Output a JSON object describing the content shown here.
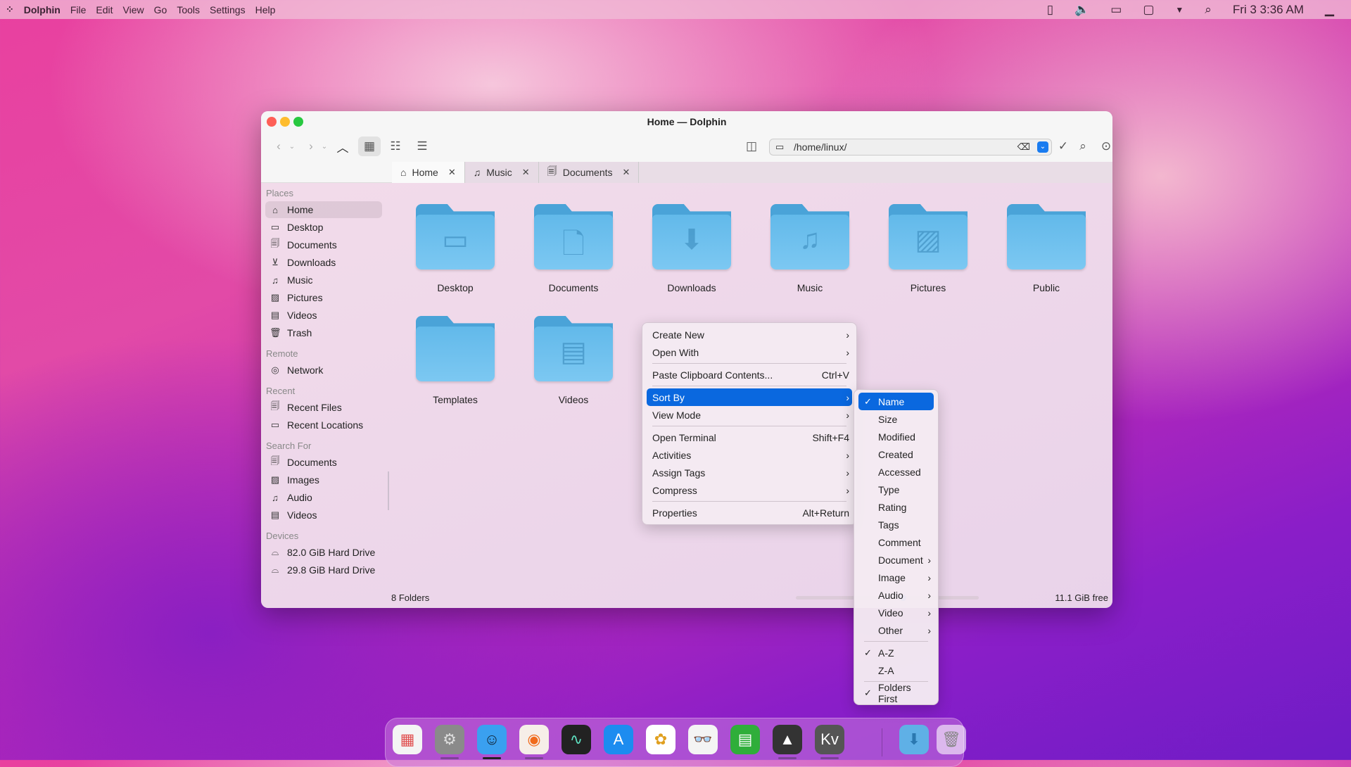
{
  "menubar": {
    "app": "Dolphin",
    "items": [
      "File",
      "Edit",
      "View",
      "Go",
      "Tools",
      "Settings",
      "Help"
    ],
    "clock": "Fri 3 3:36 AM"
  },
  "window": {
    "title": "Home — Dolphin",
    "location": "/home/linux/"
  },
  "tabs": [
    {
      "label": "Home",
      "icon": "home-icon"
    },
    {
      "label": "Music",
      "icon": "music-icon"
    },
    {
      "label": "Documents",
      "icon": "documents-icon"
    }
  ],
  "sidebar": {
    "places_heading": "Places",
    "places": [
      {
        "label": "Home",
        "icon": "⌂"
      },
      {
        "label": "Desktop",
        "icon": "▭"
      },
      {
        "label": "Documents",
        "icon": "🗐"
      },
      {
        "label": "Downloads",
        "icon": "⊻"
      },
      {
        "label": "Music",
        "icon": "♫"
      },
      {
        "label": "Pictures",
        "icon": "▨"
      },
      {
        "label": "Videos",
        "icon": "▤"
      },
      {
        "label": "Trash",
        "icon": "🗑"
      }
    ],
    "remote_heading": "Remote",
    "remote": [
      {
        "label": "Network",
        "icon": "◎"
      }
    ],
    "recent_heading": "Recent",
    "recent": [
      {
        "label": "Recent Files",
        "icon": "🗐"
      },
      {
        "label": "Recent Locations",
        "icon": "▭"
      }
    ],
    "search_heading": "Search For",
    "search": [
      {
        "label": "Documents",
        "icon": "🗐"
      },
      {
        "label": "Images",
        "icon": "▨"
      },
      {
        "label": "Audio",
        "icon": "♫"
      },
      {
        "label": "Videos",
        "icon": "▤"
      }
    ],
    "devices_heading": "Devices",
    "devices": [
      {
        "label": "82.0 GiB Hard Drive",
        "icon": "⌓"
      },
      {
        "label": "29.8 GiB Hard Drive",
        "icon": "⌓"
      }
    ]
  },
  "folders": [
    {
      "label": "Desktop",
      "glyph": "▭"
    },
    {
      "label": "Documents",
      "glyph": "🗋"
    },
    {
      "label": "Downloads",
      "glyph": "⬇"
    },
    {
      "label": "Music",
      "glyph": "♫"
    },
    {
      "label": "Pictures",
      "glyph": "▨"
    },
    {
      "label": "Public",
      "glyph": ""
    },
    {
      "label": "Templates",
      "glyph": ""
    },
    {
      "label": "Videos",
      "glyph": "▤"
    }
  ],
  "status": {
    "count": "8 Folders",
    "free": "11.1 GiB free",
    "zoom_level": 0.05,
    "disk_used_fraction": 0.0
  },
  "context_menu": [
    {
      "label": "Create New",
      "sub": true
    },
    {
      "label": "Open With",
      "sub": true
    },
    {
      "sep": true
    },
    {
      "label": "Paste Clipboard Contents...",
      "shortcut": "Ctrl+V"
    },
    {
      "sep": true
    },
    {
      "label": "Sort By",
      "sub": true,
      "highlight": true
    },
    {
      "label": "View Mode",
      "sub": true
    },
    {
      "sep": true
    },
    {
      "label": "Open Terminal",
      "shortcut": "Shift+F4"
    },
    {
      "label": "Activities",
      "sub": true
    },
    {
      "label": "Assign Tags",
      "sub": true
    },
    {
      "label": "Compress",
      "sub": true
    },
    {
      "sep": true
    },
    {
      "label": "Properties",
      "shortcut": "Alt+Return"
    }
  ],
  "sort_menu": [
    {
      "label": "Name",
      "checked": true,
      "highlight": true
    },
    {
      "label": "Size"
    },
    {
      "label": "Modified"
    },
    {
      "label": "Created"
    },
    {
      "label": "Accessed"
    },
    {
      "label": "Type"
    },
    {
      "label": "Rating"
    },
    {
      "label": "Tags"
    },
    {
      "label": "Comment"
    },
    {
      "label": "Document",
      "sub": true
    },
    {
      "label": "Image",
      "sub": true
    },
    {
      "label": "Audio",
      "sub": true
    },
    {
      "label": "Video",
      "sub": true
    },
    {
      "label": "Other",
      "sub": true
    },
    {
      "sep": true
    },
    {
      "label": "A-Z",
      "checked": true
    },
    {
      "label": "Z-A"
    },
    {
      "sep": true
    },
    {
      "label": "Folders First",
      "checked": true
    }
  ],
  "dock": [
    {
      "name": "launchpad",
      "bg": "#f4f4f4",
      "glyph": "▦",
      "color": "#e05050",
      "running": false
    },
    {
      "name": "system-settings",
      "bg": "#8a8a8a",
      "glyph": "⚙",
      "color": "#ddd",
      "running": true
    },
    {
      "name": "finder",
      "bg": "#3aa0f0",
      "glyph": "☺",
      "color": "#123",
      "running": true,
      "active": true
    },
    {
      "name": "firefox",
      "bg": "#f6eee8",
      "glyph": "◉",
      "color": "#f06a1c",
      "running": true
    },
    {
      "name": "activity-monitor",
      "bg": "#222",
      "glyph": "∿",
      "color": "#5ee0c0",
      "running": false
    },
    {
      "name": "app-store",
      "bg": "#1c8cf0",
      "glyph": "A",
      "color": "#fff",
      "running": false
    },
    {
      "name": "photos",
      "bg": "#fff",
      "glyph": "✿",
      "color": "#e0a020",
      "running": false
    },
    {
      "name": "preview",
      "bg": "#f4f4f4",
      "glyph": "👓",
      "color": "#333",
      "running": false
    },
    {
      "name": "spreadsheet",
      "bg": "#2fae3a",
      "glyph": "▤",
      "color": "#fff",
      "running": false
    },
    {
      "name": "inkscape",
      "bg": "#333",
      "glyph": "▲",
      "color": "#fff",
      "running": true
    },
    {
      "name": "kvantum",
      "bg": "#555",
      "glyph": "Kv",
      "color": "#fff",
      "running": true
    },
    {
      "name": "downloads-folder",
      "bg": "#5fb0e6",
      "glyph": "⬇",
      "color": "#2a78b0",
      "running": false
    },
    {
      "name": "trash",
      "bg": "rgba(255,255,255,.6)",
      "glyph": "🗑",
      "color": "#888",
      "running": false
    }
  ],
  "colors": {
    "accent": "#0a68df",
    "folder": "#62b9ea",
    "close": "#fe5f57",
    "minimize": "#febc2e",
    "maximize": "#28c840"
  }
}
